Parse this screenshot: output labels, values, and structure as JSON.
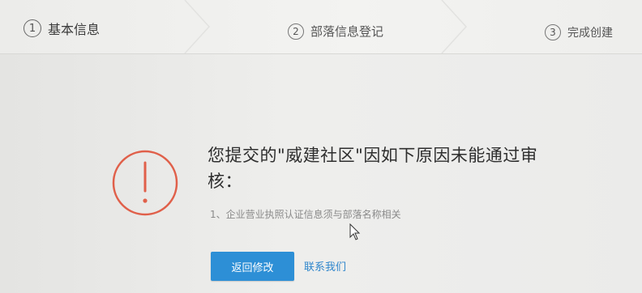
{
  "steps": [
    {
      "num": "1",
      "label": "基本信息"
    },
    {
      "num": "2",
      "label": "部落信息登记"
    },
    {
      "num": "3",
      "label": "完成创建"
    }
  ],
  "message": {
    "title": "您提交的\"威建社区\"因如下原因未能通过审核：",
    "reason": "1、企业营业执照认证信息须与部落名称相关"
  },
  "actions": {
    "back_label": "返回修改",
    "contact_label": "联系我们"
  },
  "colors": {
    "error_red": "#e0604a",
    "primary_blue": "#2d8fd6",
    "link_blue": "#2f86cc"
  },
  "icons": {
    "error": "exclamation-circle-icon",
    "cursor": "mouse-pointer-icon"
  }
}
